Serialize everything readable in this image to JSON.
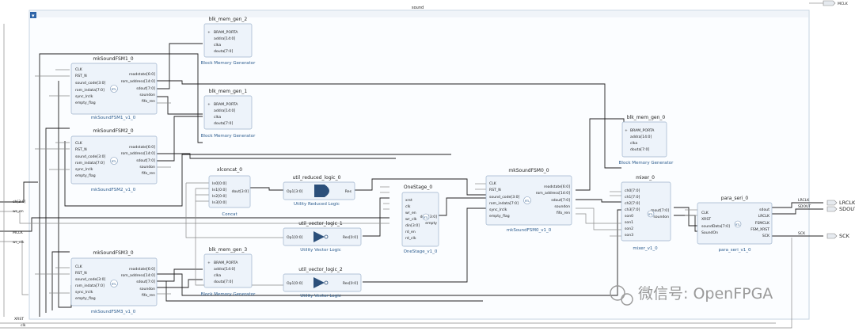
{
  "diagram": {
    "outer_title": "sound",
    "top_port": "MCLK",
    "left_ports": {
      "ch": "ch[3:0]",
      "wr_en": "wr_en",
      "mclk": "MCLK",
      "wr_clk": "wr_clk",
      "xrst": "XRST",
      "clk": "clk"
    },
    "right_ports": {
      "lrclk": "LRCLK",
      "sdout": "SDOUT",
      "sck": "SCK"
    },
    "fsm_blocks": {
      "fsm1": {
        "name": "mkSoundFSM1_0",
        "type": "mkSoundFSM1_v1_0"
      },
      "fsm2": {
        "name": "mkSoundFSM2_0",
        "type": "mkSoundFSM2_v1_0"
      },
      "fsm3": {
        "name": "mkSoundFSM3_0",
        "type": "mkSoundFSM3_v1_0"
      },
      "fsm0": {
        "name": "mkSoundFSM0_0",
        "type": "mkSoundFSM0_v1_0"
      }
    },
    "fsm_inputs": [
      "CLK",
      "RST_N",
      "sound_code[3:0]",
      "rom_indata[7:0]",
      "sync_lrclk",
      "empty_flag"
    ],
    "fsm_outputs": [
      "readstate[6:0]",
      "rom_address[14:0]",
      "sdout[7:0]",
      "soundon",
      "fifo_ren"
    ],
    "bram_blocks": {
      "b2": {
        "name": "blk_mem_gen_2"
      },
      "b1": {
        "name": "blk_mem_gen_1"
      },
      "b3": {
        "name": "blk_mem_gen_3"
      },
      "b0": {
        "name": "blk_mem_gen_0"
      }
    },
    "bram_type": "Block Memory Generator",
    "bram_pins": [
      "BRAM_PORTA",
      "addra[14:0]",
      "clka",
      "douta[7:0]"
    ],
    "xlconcat": {
      "name": "xlconcat_0",
      "type": "Concat",
      "inputs": [
        "In0[0:0]",
        "In1[0:0]",
        "In2[0:0]",
        "In3[0:0]"
      ],
      "output": "dout[3:0]"
    },
    "reduced": {
      "name": "util_reduced_logic_0",
      "type": "Utility Reduced Logic",
      "input": "Op1[3:0]",
      "output": "Res"
    },
    "vec1": {
      "name": "util_vector_logic_1",
      "type": "Utility Vector Logic",
      "input": "Op1[0:0]",
      "output": "Res[0:0]"
    },
    "vec2": {
      "name": "util_vector_logic_2",
      "type": "Utility Vector Logic",
      "input": "Op1[0:0]",
      "output": "Res[0:0]"
    },
    "onestage": {
      "name": "OneStage_0",
      "type": "OneStage_v1_0",
      "inputs": [
        "xrst",
        "clk",
        "wr_en",
        "wr_clk",
        "din[3:0]",
        "rd_en",
        "rd_clk"
      ],
      "outputs": [
        "dout[3:0]",
        "empty"
      ]
    },
    "mixer": {
      "name": "mixer_0",
      "type": "mixer_v1_0",
      "inputs": [
        "ch0[7:0]",
        "ch1[7:0]",
        "ch2[7:0]",
        "ch3[7:0]",
        "son0",
        "son1",
        "son2",
        "son3"
      ],
      "outputs": [
        "mout[7:0]",
        "soundon"
      ]
    },
    "para_seri": {
      "name": "para_seri_0",
      "type": "para_seri_v1_0",
      "inputs": [
        "CLK",
        "XRST",
        "soundData[7:0]",
        "SoundOn"
      ],
      "outputs": [
        "sdout",
        "LRCLK",
        "FSMCLK",
        "FSM_XRST",
        "SCK"
      ]
    },
    "rtl_badge": "RTL",
    "watermark": "微信号: OpenFPGA"
  }
}
